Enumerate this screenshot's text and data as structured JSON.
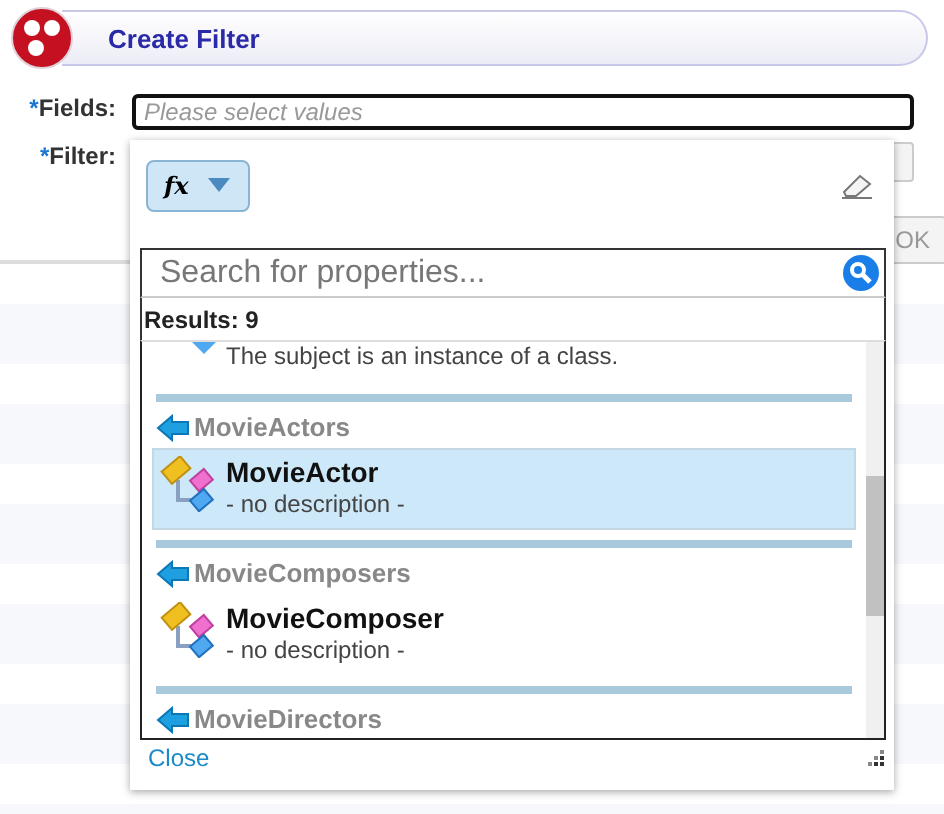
{
  "header": {
    "title": "Create Filter"
  },
  "form": [
    {
      "marker": "*",
      "label": "Fields:",
      "placeholder": "Please select values"
    },
    {
      "marker": "*",
      "label": "Filter:"
    }
  ],
  "ok_button": "OK",
  "popup": {
    "function_button": "fx",
    "search": {
      "placeholder": "Search for properties..."
    },
    "results": "Results: 9",
    "entries": [
      {
        "kind": "fragment",
        "description": "The subject is an instance of a class."
      },
      {
        "kind": "group",
        "label": "MovieActors"
      },
      {
        "kind": "item",
        "label": "MovieActor",
        "description": "- no description -",
        "selected": true
      },
      {
        "kind": "group",
        "label": "MovieComposers"
      },
      {
        "kind": "item",
        "label": "MovieComposer",
        "description": "- no description -",
        "selected": false
      },
      {
        "kind": "group",
        "label": "MovieDirectors"
      }
    ],
    "close": "Close"
  }
}
